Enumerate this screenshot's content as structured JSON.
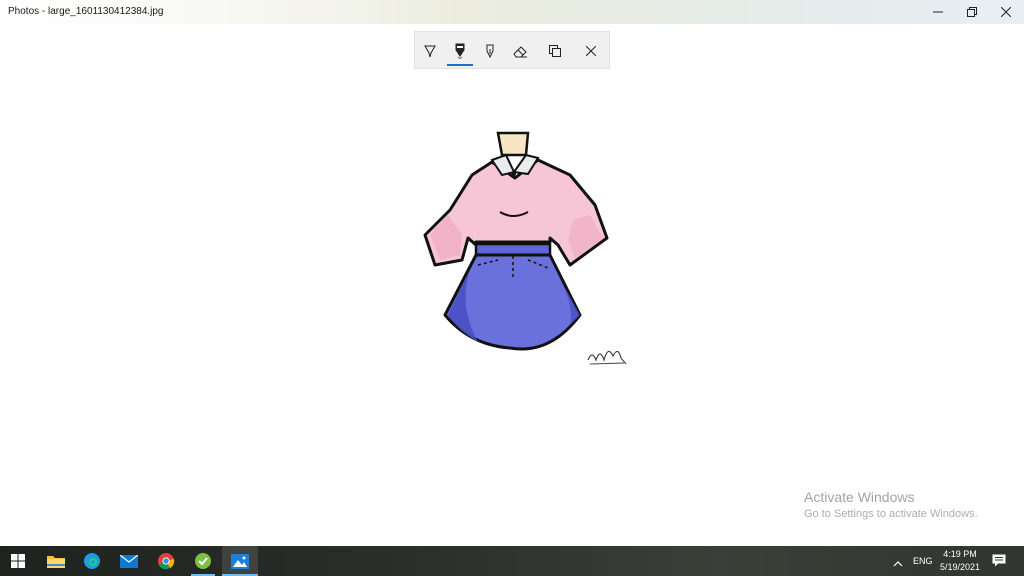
{
  "window": {
    "title": "Photos - large_1601130412384.jpg",
    "controls": [
      "minimize",
      "restore",
      "close"
    ]
  },
  "ink_toolbar": {
    "tools": [
      {
        "name": "ballpoint-pen",
        "active": false
      },
      {
        "name": "pencil",
        "active": true
      },
      {
        "name": "calligraphy-pen",
        "active": false
      },
      {
        "name": "eraser",
        "active": false
      },
      {
        "name": "copy",
        "active": false
      },
      {
        "name": "close",
        "active": false
      }
    ]
  },
  "watermark": {
    "title": "Activate Windows",
    "subtitle": "Go to Settings to activate Windows."
  },
  "taskbar": {
    "apps": [
      "windows-start",
      "file-explorer",
      "edge",
      "mail",
      "chrome",
      "app-green",
      "photos"
    ],
    "tray": {
      "language": "ENG",
      "time": "4:19 PM",
      "date": "5/19/2021"
    }
  },
  "colors": {
    "shirt": "#f6c6d6",
    "skirt": "#5f66d8",
    "accent_blue": "#1a73c9"
  }
}
